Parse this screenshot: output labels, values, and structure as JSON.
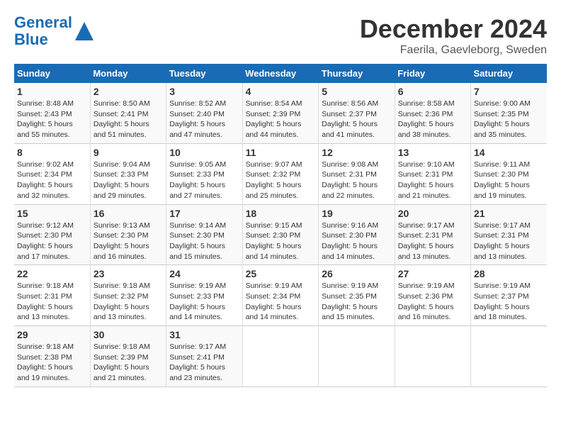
{
  "logo": {
    "text_general": "General",
    "text_blue": "Blue"
  },
  "calendar": {
    "title": "December 2024",
    "subtitle": "Faerila, Gaevleborg, Sweden"
  },
  "days_of_week": [
    "Sunday",
    "Monday",
    "Tuesday",
    "Wednesday",
    "Thursday",
    "Friday",
    "Saturday"
  ],
  "weeks": [
    [
      {
        "day": "1",
        "info": "Sunrise: 8:48 AM\nSunset: 2:43 PM\nDaylight: 5 hours\nand 55 minutes."
      },
      {
        "day": "2",
        "info": "Sunrise: 8:50 AM\nSunset: 2:41 PM\nDaylight: 5 hours\nand 51 minutes."
      },
      {
        "day": "3",
        "info": "Sunrise: 8:52 AM\nSunset: 2:40 PM\nDaylight: 5 hours\nand 47 minutes."
      },
      {
        "day": "4",
        "info": "Sunrise: 8:54 AM\nSunset: 2:39 PM\nDaylight: 5 hours\nand 44 minutes."
      },
      {
        "day": "5",
        "info": "Sunrise: 8:56 AM\nSunset: 2:37 PM\nDaylight: 5 hours\nand 41 minutes."
      },
      {
        "day": "6",
        "info": "Sunrise: 8:58 AM\nSunset: 2:36 PM\nDaylight: 5 hours\nand 38 minutes."
      },
      {
        "day": "7",
        "info": "Sunrise: 9:00 AM\nSunset: 2:35 PM\nDaylight: 5 hours\nand 35 minutes."
      }
    ],
    [
      {
        "day": "8",
        "info": "Sunrise: 9:02 AM\nSunset: 2:34 PM\nDaylight: 5 hours\nand 32 minutes."
      },
      {
        "day": "9",
        "info": "Sunrise: 9:04 AM\nSunset: 2:33 PM\nDaylight: 5 hours\nand 29 minutes."
      },
      {
        "day": "10",
        "info": "Sunrise: 9:05 AM\nSunset: 2:33 PM\nDaylight: 5 hours\nand 27 minutes."
      },
      {
        "day": "11",
        "info": "Sunrise: 9:07 AM\nSunset: 2:32 PM\nDaylight: 5 hours\nand 25 minutes."
      },
      {
        "day": "12",
        "info": "Sunrise: 9:08 AM\nSunset: 2:31 PM\nDaylight: 5 hours\nand 22 minutes."
      },
      {
        "day": "13",
        "info": "Sunrise: 9:10 AM\nSunset: 2:31 PM\nDaylight: 5 hours\nand 21 minutes."
      },
      {
        "day": "14",
        "info": "Sunrise: 9:11 AM\nSunset: 2:30 PM\nDaylight: 5 hours\nand 19 minutes."
      }
    ],
    [
      {
        "day": "15",
        "info": "Sunrise: 9:12 AM\nSunset: 2:30 PM\nDaylight: 5 hours\nand 17 minutes."
      },
      {
        "day": "16",
        "info": "Sunrise: 9:13 AM\nSunset: 2:30 PM\nDaylight: 5 hours\nand 16 minutes."
      },
      {
        "day": "17",
        "info": "Sunrise: 9:14 AM\nSunset: 2:30 PM\nDaylight: 5 hours\nand 15 minutes."
      },
      {
        "day": "18",
        "info": "Sunrise: 9:15 AM\nSunset: 2:30 PM\nDaylight: 5 hours\nand 14 minutes."
      },
      {
        "day": "19",
        "info": "Sunrise: 9:16 AM\nSunset: 2:30 PM\nDaylight: 5 hours\nand 14 minutes."
      },
      {
        "day": "20",
        "info": "Sunrise: 9:17 AM\nSunset: 2:31 PM\nDaylight: 5 hours\nand 13 minutes."
      },
      {
        "day": "21",
        "info": "Sunrise: 9:17 AM\nSunset: 2:31 PM\nDaylight: 5 hours\nand 13 minutes."
      }
    ],
    [
      {
        "day": "22",
        "info": "Sunrise: 9:18 AM\nSunset: 2:31 PM\nDaylight: 5 hours\nand 13 minutes."
      },
      {
        "day": "23",
        "info": "Sunrise: 9:18 AM\nSunset: 2:32 PM\nDaylight: 5 hours\nand 13 minutes."
      },
      {
        "day": "24",
        "info": "Sunrise: 9:19 AM\nSunset: 2:33 PM\nDaylight: 5 hours\nand 14 minutes."
      },
      {
        "day": "25",
        "info": "Sunrise: 9:19 AM\nSunset: 2:34 PM\nDaylight: 5 hours\nand 14 minutes."
      },
      {
        "day": "26",
        "info": "Sunrise: 9:19 AM\nSunset: 2:35 PM\nDaylight: 5 hours\nand 15 minutes."
      },
      {
        "day": "27",
        "info": "Sunrise: 9:19 AM\nSunset: 2:36 PM\nDaylight: 5 hours\nand 16 minutes."
      },
      {
        "day": "28",
        "info": "Sunrise: 9:19 AM\nSunset: 2:37 PM\nDaylight: 5 hours\nand 18 minutes."
      }
    ],
    [
      {
        "day": "29",
        "info": "Sunrise: 9:18 AM\nSunset: 2:38 PM\nDaylight: 5 hours\nand 19 minutes."
      },
      {
        "day": "30",
        "info": "Sunrise: 9:18 AM\nSunset: 2:39 PM\nDaylight: 5 hours\nand 21 minutes."
      },
      {
        "day": "31",
        "info": "Sunrise: 9:17 AM\nSunset: 2:41 PM\nDaylight: 5 hours\nand 23 minutes."
      },
      {
        "day": "",
        "info": ""
      },
      {
        "day": "",
        "info": ""
      },
      {
        "day": "",
        "info": ""
      },
      {
        "day": "",
        "info": ""
      }
    ]
  ]
}
